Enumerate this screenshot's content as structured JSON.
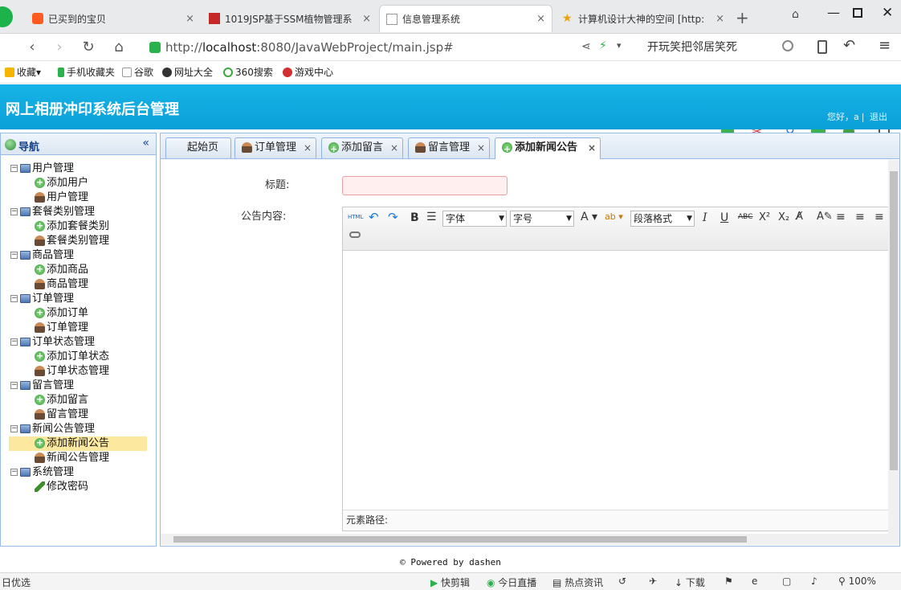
{
  "browser": {
    "tabs": [
      {
        "title": "已买到的宝贝"
      },
      {
        "title": "1019JSP基于SSM植物管理系"
      },
      {
        "title": "信息管理系统"
      },
      {
        "title": "计算机设计大神的空间 [http:"
      }
    ],
    "url_prefix": "http://",
    "url_host": "localhost",
    "url_rest": ":8080/JavaWebProject/main.jsp#",
    "search_text": "开玩笑把邻居笑死",
    "bookmarks": [
      "收藏",
      "手机收藏夹",
      "谷歌",
      "网址大全",
      "360搜索",
      "游戏中心"
    ]
  },
  "app": {
    "title": "网上相册冲印系统后台管理",
    "greeting": "您好，a",
    "logout": "退出"
  },
  "sidebar": {
    "title": "导航",
    "groups": [
      {
        "label": "用户管理",
        "items": [
          "添加用户",
          "用户管理"
        ]
      },
      {
        "label": "套餐类别管理",
        "items": [
          "添加套餐类别",
          "套餐类别管理"
        ]
      },
      {
        "label": "商品管理",
        "items": [
          "添加商品",
          "商品管理"
        ]
      },
      {
        "label": "订单管理",
        "items": [
          "添加订单",
          "订单管理"
        ]
      },
      {
        "label": "订单状态管理",
        "items": [
          "添加订单状态",
          "订单状态管理"
        ]
      },
      {
        "label": "留言管理",
        "items": [
          "添加留言",
          "留言管理"
        ]
      },
      {
        "label": "新闻公告管理",
        "items": [
          "添加新闻公告",
          "新闻公告管理"
        ]
      },
      {
        "label": "系统管理",
        "items": [
          "修改密码"
        ]
      }
    ]
  },
  "content_tabs": [
    "起始页",
    "订单管理",
    "添加留言",
    "留言管理",
    "添加新闻公告"
  ],
  "form": {
    "title_label": "标题:",
    "content_label": "公告内容:",
    "title_value": "",
    "font_label": "字体",
    "size_label": "字号",
    "format_label": "段落格式",
    "path_label": "元素路径:"
  },
  "footer": {
    "powered": "© Powered by dashen"
  },
  "status": {
    "left": "日优选",
    "items": [
      "快剪辑",
      "今日直播",
      "热点资讯",
      "下载"
    ],
    "zoom": "100%"
  }
}
